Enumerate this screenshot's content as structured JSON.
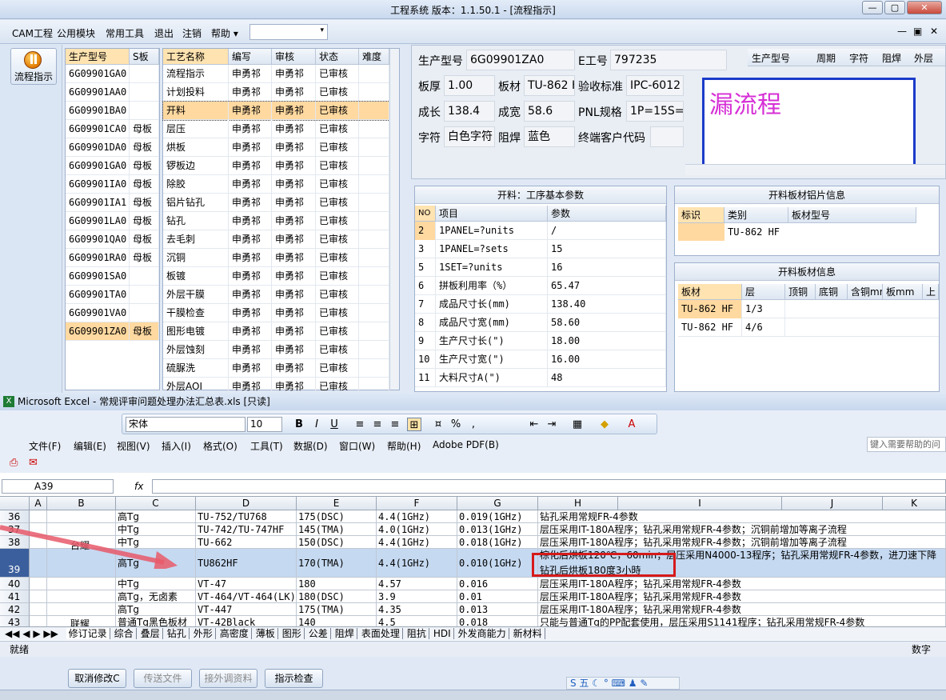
{
  "window": {
    "title": "工程系统   版本：1.1.50.1 - [流程指示]",
    "controls": [
      "—",
      "▢",
      "✕"
    ]
  },
  "menu": [
    "CAM工程",
    "公用模块",
    "常用工具",
    "退出",
    "注销",
    "帮助 ▾"
  ],
  "mdi_controls": [
    "—",
    "▣",
    "✕"
  ],
  "launcher": {
    "flow_label": "流程指示"
  },
  "models": {
    "headers": [
      "生产型号",
      "S板"
    ],
    "rows": [
      [
        "6G09901GA0",
        ""
      ],
      [
        "6G09901AA0",
        ""
      ],
      [
        "6G09901BA0",
        ""
      ],
      [
        "6G09901CA0",
        "母板"
      ],
      [
        "6G09901DA0",
        "母板"
      ],
      [
        "6G09901GA0",
        "母板"
      ],
      [
        "6G09901IA0",
        "母板"
      ],
      [
        "6G09901IA1",
        "母板"
      ],
      [
        "6G09901LA0",
        "母板"
      ],
      [
        "6G09901QA0",
        "母板"
      ],
      [
        "6G09901RA0",
        "母板"
      ],
      [
        "6G09901SA0",
        ""
      ],
      [
        "6G09901TA0",
        ""
      ],
      [
        "6G09901VA0",
        ""
      ],
      [
        "6G09901ZA0",
        "母板"
      ]
    ],
    "selected_index": 14
  },
  "processes": {
    "headers": [
      "工艺名称",
      "编写",
      "审核",
      "状态",
      "难度"
    ],
    "rows": [
      [
        "流程指示",
        "申勇祁",
        "申勇祁",
        "已审核"
      ],
      [
        "计划投料",
        "申勇祁",
        "申勇祁",
        "已审核"
      ],
      [
        "开料",
        "申勇祁",
        "申勇祁",
        "已审核"
      ],
      [
        "层压",
        "申勇祁",
        "申勇祁",
        "已审核"
      ],
      [
        "烘板",
        "申勇祁",
        "申勇祁",
        "已审核"
      ],
      [
        "锣板边",
        "申勇祁",
        "申勇祁",
        "已审核"
      ],
      [
        "除胶",
        "申勇祁",
        "申勇祁",
        "已审核"
      ],
      [
        "铝片钻孔",
        "申勇祁",
        "申勇祁",
        "已审核"
      ],
      [
        "钻孔",
        "申勇祁",
        "申勇祁",
        "已审核"
      ],
      [
        "去毛刺",
        "申勇祁",
        "申勇祁",
        "已审核"
      ],
      [
        "沉铜",
        "申勇祁",
        "申勇祁",
        "已审核"
      ],
      [
        "板镀",
        "申勇祁",
        "申勇祁",
        "已审核"
      ],
      [
        "外层干膜",
        "申勇祁",
        "申勇祁",
        "已审核"
      ],
      [
        "干膜检查",
        "申勇祁",
        "申勇祁",
        "已审核"
      ],
      [
        "图形电镀",
        "申勇祁",
        "申勇祁",
        "已审核"
      ],
      [
        "外层蚀刻",
        "申勇祁",
        "申勇祁",
        "已审核"
      ],
      [
        "硫脲洗",
        "申勇祁",
        "申勇祁",
        "已审核"
      ],
      [
        "外层AOI",
        "申勇祁",
        "申勇祁",
        "已审核"
      ]
    ],
    "selected_index": 2
  },
  "info": {
    "model_label": "生产型号",
    "model_value": "6G09901ZA0",
    "eno_label": "E工号",
    "eno_value": "797235",
    "thick_label": "板厚",
    "thick_value": "1.00",
    "material_label": "板材",
    "material_value": "TU-862 H",
    "std_label": "验收标准",
    "std_value": "IPC-6012",
    "len_label": "成长",
    "len_value": "138.4",
    "wid_label": "成宽",
    "wid_value": "58.6",
    "pnl_label": "PNL规格",
    "pnl_value": "1P=15S=1",
    "char_label": "字符",
    "char_value": "白色字符",
    "mask_label": "阻焊",
    "mask_value": "蓝色",
    "cust_label": "终端客户代码",
    "cust_value": "",
    "right_headers": [
      "生产型号",
      "周期",
      "字符",
      "阻焊",
      "外层"
    ],
    "note_text": "漏流程"
  },
  "params": {
    "title": "开料：工序基本参数",
    "headers": [
      "NO",
      "项目",
      "参数"
    ],
    "rows": [
      [
        "2",
        "1PANEL=?units",
        "/"
      ],
      [
        "3",
        "1PANEL=?sets",
        "15"
      ],
      [
        "5",
        "1SET=?units",
        "16"
      ],
      [
        "6",
        "拼板利用率（%）",
        "65.47"
      ],
      [
        "7",
        "成品尺寸长(mm)",
        "138.40"
      ],
      [
        "8",
        "成品尺寸宽(mm)",
        "58.60"
      ],
      [
        "9",
        "生产尺寸长(\")",
        "18.00"
      ],
      [
        "10",
        "生产尺寸宽(\")",
        "16.00"
      ],
      [
        "11",
        "大料尺寸A(\")",
        "48"
      ]
    ]
  },
  "alu": {
    "title": "开料板材铝片信息",
    "headers": [
      "标识",
      "类别",
      "板材型号"
    ],
    "rows": [
      [
        "",
        "TU-862 HF",
        ""
      ]
    ]
  },
  "board": {
    "title": "开料板材信息",
    "headers": [
      "板材",
      "层",
      "顶铜",
      "底铜",
      "含铜mm",
      "板mm",
      "上"
    ],
    "rows": [
      [
        "TU-862 HF",
        "1/3"
      ],
      [
        "TU-862 HF",
        "4/6"
      ]
    ]
  },
  "excel": {
    "title": "Microsoft Excel - 常规评审问题处理办法汇总表.xls  [只读]",
    "font_name": "宋体",
    "font_size": "10",
    "menus": [
      "文件(F)",
      "编辑(E)",
      "视图(V)",
      "插入(I)",
      "格式(O)",
      "工具(T)",
      "数据(D)",
      "窗口(W)",
      "帮助(H)",
      "Adobe PDF(B)"
    ],
    "help_placeholder": "键入需要帮助的问",
    "cell_ref": "A39",
    "fx": "fx",
    "columns": [
      "A",
      "B",
      "C",
      "D",
      "E",
      "F",
      "G",
      "H",
      "I",
      "J",
      "K"
    ],
    "rows": [
      {
        "n": "36",
        "c": "高Tg",
        "d": "TU-752/TU768",
        "e": "175(DSC)",
        "f": "4.4(1GHz)",
        "g": "0.019(1GHz)",
        "h": "钻孔采用常规FR-4参数"
      },
      {
        "n": "37",
        "c": "中Tg",
        "d": "TU-742/TU-747HF",
        "e": "145(TMA)",
        "f": "4.0(1GHz)",
        "g": "0.013(1GHz)",
        "h": "层压采用IT-180A程序；钻孔采用常规FR-4参数；沉铜前增加等离子流程"
      },
      {
        "n": "38",
        "c": "中Tg",
        "d": "TU-662",
        "e": "150(DSC)",
        "f": "4.4(1GHz)",
        "g": "0.018(1GHz)",
        "h": "层压采用IT-180A程序；钻孔采用常规FR-4参数；沉铜前增加等离子流程"
      },
      {
        "n": "39",
        "c": "高Tg",
        "d": "TU862HF",
        "e": "170(TMA)",
        "f": "4.4(1GHz)",
        "g": "0.010(1GHz)",
        "h": "棕化后烘板120℃，60min；层压采用N4000-13程序；钻孔采用常规FR-4参数，进刀速下降",
        "h2": "钻孔后烘板180度3小時"
      },
      {
        "n": "40",
        "c": "中Tg",
        "d": "VT-47",
        "e": "180",
        "f": "4.57",
        "g": "0.016",
        "h": "层压采用IT-180A程序；钻孔采用常规FR-4参数"
      },
      {
        "n": "41",
        "c": "高Tg，无卤素",
        "d": "VT-464/VT-464(LK)",
        "e": "180(DSC)",
        "f": "3.9",
        "g": "0.01",
        "h": "层压采用IT-180A程序；钻孔采用常规FR-4参数"
      },
      {
        "n": "42",
        "c": "高Tg",
        "d": "VT-447",
        "e": "175(TMA)",
        "f": "4.35",
        "g": "0.013",
        "h": "层压采用IT-180A程序；钻孔采用常规FR-4参数"
      },
      {
        "n": "43",
        "c": "普通Tg黑色板材",
        "d": "VT-42Black",
        "e": "140",
        "f": "4.5",
        "g": "0.018",
        "h": "只能与普通Tg的PP配套使用，层压采用S1141程序；钻孔采用常规FR-4参数"
      }
    ],
    "group_b1": "台耀",
    "group_b2": "联耀",
    "sheet_tabs": [
      "修订记录",
      "综合",
      "叠层",
      "钻孔",
      "外形",
      "高密度",
      "薄板",
      "图形",
      "公差",
      "阻焊",
      "表面处理",
      "阻抗",
      "HDI",
      "外发商能力",
      "新材料"
    ],
    "status_ready": "就绪",
    "status_num": "数字"
  },
  "buttons": [
    "取消修改C",
    "传送文件",
    "接外调资料",
    "指示检查"
  ],
  "accent": "#1a3bc9",
  "highlight_red": "#d61a1a",
  "selection": "#ffd9a0"
}
